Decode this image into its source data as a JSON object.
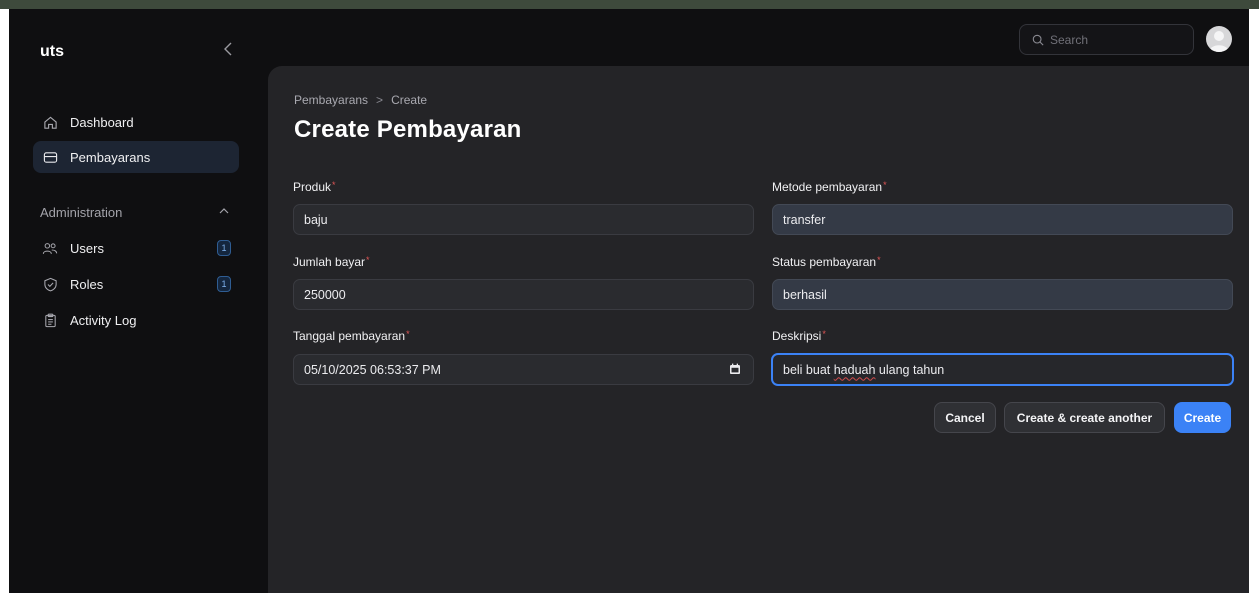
{
  "app": {
    "brand": "uts"
  },
  "sidebar": {
    "nav": [
      {
        "label": "Dashboard",
        "icon": "home-icon",
        "active": false
      },
      {
        "label": "Pembayarans",
        "icon": "card-icon",
        "active": true
      }
    ],
    "group": {
      "label": "Administration",
      "items": [
        {
          "label": "Users",
          "icon": "users-icon",
          "badge": "1"
        },
        {
          "label": "Roles",
          "icon": "shield-icon",
          "badge": "1"
        },
        {
          "label": "Activity Log",
          "icon": "clipboard-icon"
        }
      ]
    }
  },
  "topbar": {
    "search_placeholder": "Search"
  },
  "breadcrumb": {
    "parent": "Pembayarans",
    "separator": ">",
    "current": "Create"
  },
  "page": {
    "title": "Create Pembayaran"
  },
  "form": {
    "required_mark": "*",
    "produk": {
      "label": "Produk",
      "value": "baju"
    },
    "metode": {
      "label": "Metode pembayaran",
      "value": "transfer"
    },
    "jumlah": {
      "label": "Jumlah bayar",
      "value": "250000"
    },
    "status": {
      "label": "Status pembayaran",
      "value": "berhasil"
    },
    "tanggal": {
      "label": "Tanggal pembayaran",
      "value": "05/10/2025 06:53:37 PM"
    },
    "deskripsi": {
      "label": "Deskripsi",
      "value_prefix": "beli buat ",
      "value_misspelled": "haduah",
      "value_suffix": " ulang tahun"
    }
  },
  "actions": {
    "cancel": "Cancel",
    "create_another": "Create & create another",
    "create": "Create"
  },
  "colors": {
    "primary": "#3b82f6",
    "required": "#e05555",
    "sidebar_active": "#1d2533",
    "panel": "#242427"
  }
}
